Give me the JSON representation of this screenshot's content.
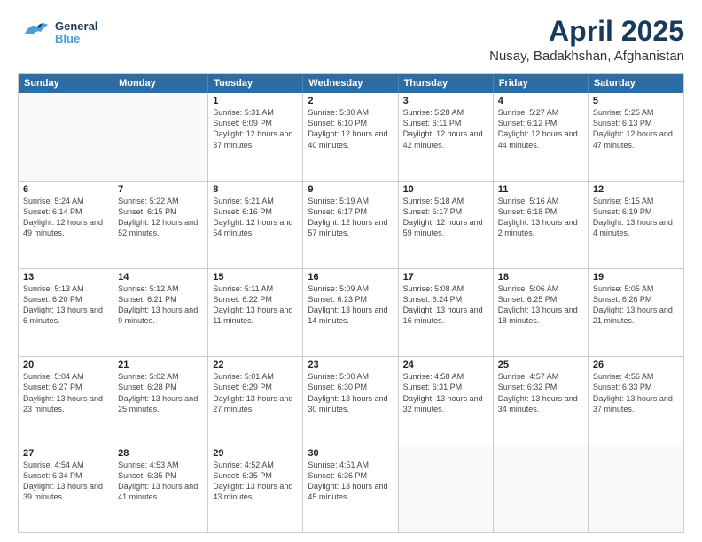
{
  "header": {
    "logo_general": "General",
    "logo_blue": "Blue",
    "title": "April 2025",
    "subtitle": "Nusay, Badakhshan, Afghanistan"
  },
  "calendar": {
    "days_of_week": [
      "Sunday",
      "Monday",
      "Tuesday",
      "Wednesday",
      "Thursday",
      "Friday",
      "Saturday"
    ],
    "rows": [
      [
        {
          "day": "",
          "text": ""
        },
        {
          "day": "",
          "text": ""
        },
        {
          "day": "1",
          "text": "Sunrise: 5:31 AM\nSunset: 6:09 PM\nDaylight: 12 hours and 37 minutes."
        },
        {
          "day": "2",
          "text": "Sunrise: 5:30 AM\nSunset: 6:10 PM\nDaylight: 12 hours and 40 minutes."
        },
        {
          "day": "3",
          "text": "Sunrise: 5:28 AM\nSunset: 6:11 PM\nDaylight: 12 hours and 42 minutes."
        },
        {
          "day": "4",
          "text": "Sunrise: 5:27 AM\nSunset: 6:12 PM\nDaylight: 12 hours and 44 minutes."
        },
        {
          "day": "5",
          "text": "Sunrise: 5:25 AM\nSunset: 6:13 PM\nDaylight: 12 hours and 47 minutes."
        }
      ],
      [
        {
          "day": "6",
          "text": "Sunrise: 5:24 AM\nSunset: 6:14 PM\nDaylight: 12 hours and 49 minutes."
        },
        {
          "day": "7",
          "text": "Sunrise: 5:22 AM\nSunset: 6:15 PM\nDaylight: 12 hours and 52 minutes."
        },
        {
          "day": "8",
          "text": "Sunrise: 5:21 AM\nSunset: 6:16 PM\nDaylight: 12 hours and 54 minutes."
        },
        {
          "day": "9",
          "text": "Sunrise: 5:19 AM\nSunset: 6:17 PM\nDaylight: 12 hours and 57 minutes."
        },
        {
          "day": "10",
          "text": "Sunrise: 5:18 AM\nSunset: 6:17 PM\nDaylight: 12 hours and 59 minutes."
        },
        {
          "day": "11",
          "text": "Sunrise: 5:16 AM\nSunset: 6:18 PM\nDaylight: 13 hours and 2 minutes."
        },
        {
          "day": "12",
          "text": "Sunrise: 5:15 AM\nSunset: 6:19 PM\nDaylight: 13 hours and 4 minutes."
        }
      ],
      [
        {
          "day": "13",
          "text": "Sunrise: 5:13 AM\nSunset: 6:20 PM\nDaylight: 13 hours and 6 minutes."
        },
        {
          "day": "14",
          "text": "Sunrise: 5:12 AM\nSunset: 6:21 PM\nDaylight: 13 hours and 9 minutes."
        },
        {
          "day": "15",
          "text": "Sunrise: 5:11 AM\nSunset: 6:22 PM\nDaylight: 13 hours and 11 minutes."
        },
        {
          "day": "16",
          "text": "Sunrise: 5:09 AM\nSunset: 6:23 PM\nDaylight: 13 hours and 14 minutes."
        },
        {
          "day": "17",
          "text": "Sunrise: 5:08 AM\nSunset: 6:24 PM\nDaylight: 13 hours and 16 minutes."
        },
        {
          "day": "18",
          "text": "Sunrise: 5:06 AM\nSunset: 6:25 PM\nDaylight: 13 hours and 18 minutes."
        },
        {
          "day": "19",
          "text": "Sunrise: 5:05 AM\nSunset: 6:26 PM\nDaylight: 13 hours and 21 minutes."
        }
      ],
      [
        {
          "day": "20",
          "text": "Sunrise: 5:04 AM\nSunset: 6:27 PM\nDaylight: 13 hours and 23 minutes."
        },
        {
          "day": "21",
          "text": "Sunrise: 5:02 AM\nSunset: 6:28 PM\nDaylight: 13 hours and 25 minutes."
        },
        {
          "day": "22",
          "text": "Sunrise: 5:01 AM\nSunset: 6:29 PM\nDaylight: 13 hours and 27 minutes."
        },
        {
          "day": "23",
          "text": "Sunrise: 5:00 AM\nSunset: 6:30 PM\nDaylight: 13 hours and 30 minutes."
        },
        {
          "day": "24",
          "text": "Sunrise: 4:58 AM\nSunset: 6:31 PM\nDaylight: 13 hours and 32 minutes."
        },
        {
          "day": "25",
          "text": "Sunrise: 4:57 AM\nSunset: 6:32 PM\nDaylight: 13 hours and 34 minutes."
        },
        {
          "day": "26",
          "text": "Sunrise: 4:56 AM\nSunset: 6:33 PM\nDaylight: 13 hours and 37 minutes."
        }
      ],
      [
        {
          "day": "27",
          "text": "Sunrise: 4:54 AM\nSunset: 6:34 PM\nDaylight: 13 hours and 39 minutes."
        },
        {
          "day": "28",
          "text": "Sunrise: 4:53 AM\nSunset: 6:35 PM\nDaylight: 13 hours and 41 minutes."
        },
        {
          "day": "29",
          "text": "Sunrise: 4:52 AM\nSunset: 6:35 PM\nDaylight: 13 hours and 43 minutes."
        },
        {
          "day": "30",
          "text": "Sunrise: 4:51 AM\nSunset: 6:36 PM\nDaylight: 13 hours and 45 minutes."
        },
        {
          "day": "",
          "text": ""
        },
        {
          "day": "",
          "text": ""
        },
        {
          "day": "",
          "text": ""
        }
      ]
    ]
  }
}
